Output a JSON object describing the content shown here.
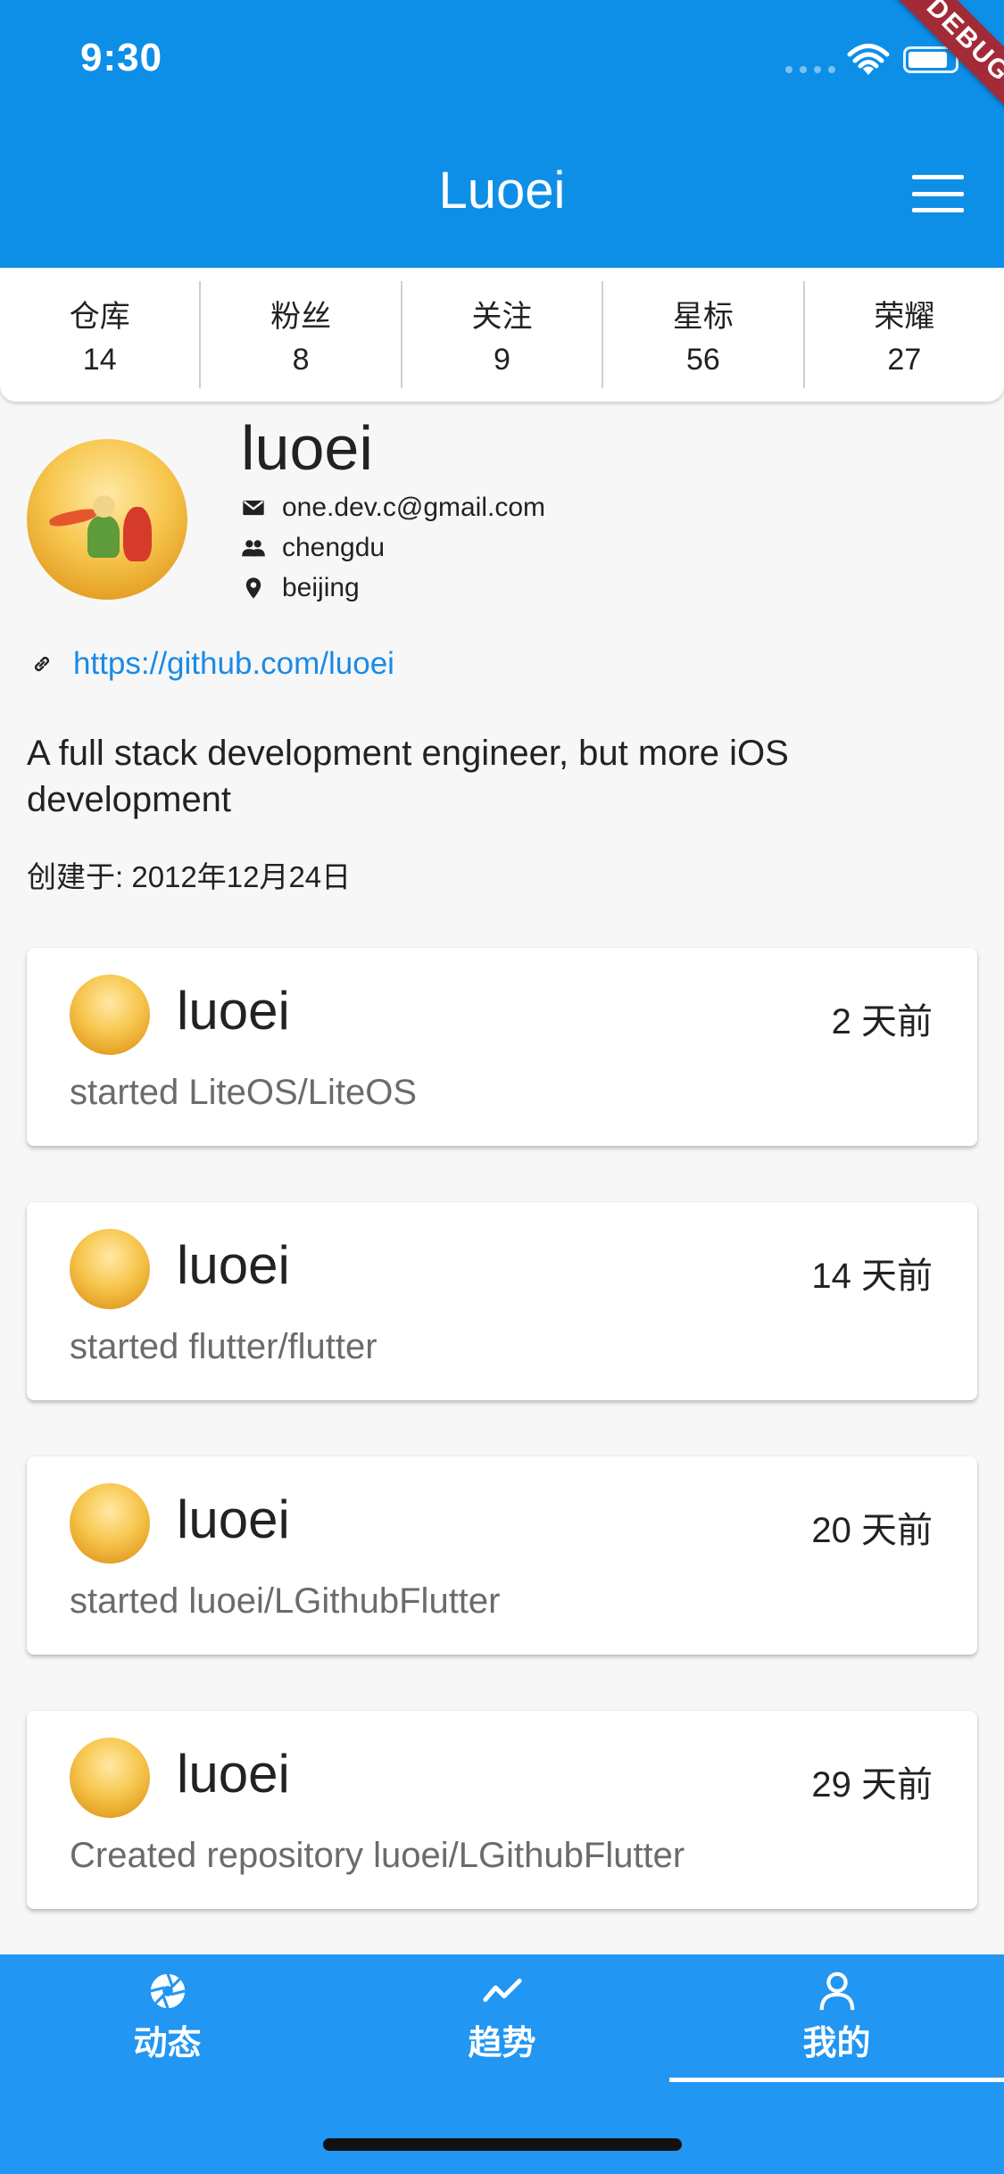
{
  "status_bar": {
    "time": "9:30",
    "debug_label": "DEBUG"
  },
  "app_bar": {
    "title": "Luoei",
    "menu_icon": "menu-icon"
  },
  "stats": [
    {
      "label": "仓库",
      "value": "14"
    },
    {
      "label": "粉丝",
      "value": "8"
    },
    {
      "label": "关注",
      "value": "9"
    },
    {
      "label": "星标",
      "value": "56"
    },
    {
      "label": "荣耀",
      "value": "27"
    }
  ],
  "profile": {
    "username": "luoei",
    "email": "one.dev.c@gmail.com",
    "company": "chengdu",
    "location": "beijing",
    "link": "https://github.com/luoei",
    "bio": "A full stack development engineer, but more iOS development",
    "created": "创建于: 2012年12月24日"
  },
  "events": [
    {
      "user": "luoei",
      "time": "2 天前",
      "action": "started LiteOS/LiteOS"
    },
    {
      "user": "luoei",
      "time": "14 天前",
      "action": "started flutter/flutter"
    },
    {
      "user": "luoei",
      "time": "20 天前",
      "action": "started luoei/LGithubFlutter"
    },
    {
      "user": "luoei",
      "time": "29 天前",
      "action": "Created repository luoei/LGithubFlutter"
    }
  ],
  "bottom_nav": {
    "items": [
      {
        "label": "动态",
        "icon": "aperture-icon"
      },
      {
        "label": "趋势",
        "icon": "trend-icon"
      },
      {
        "label": "我的",
        "icon": "person-icon"
      }
    ],
    "selected": "我的"
  },
  "colors": {
    "primary": "#0d8fe8",
    "nav": "#2196f3",
    "link": "#1a8ae6"
  }
}
